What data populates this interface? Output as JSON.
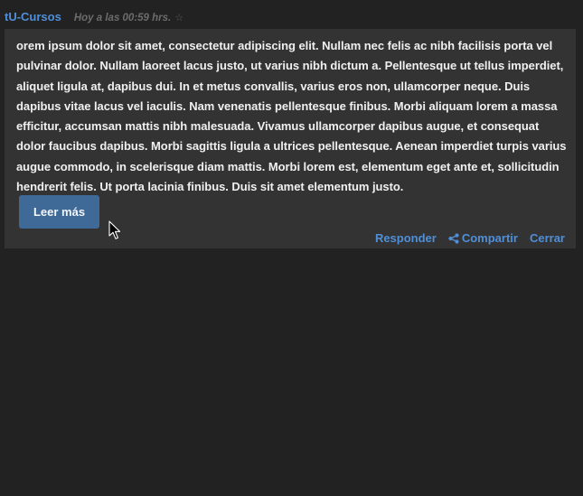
{
  "post": {
    "author": "tU-Cursos",
    "timestamp": "Hoy a las 00:59 hrs.",
    "star_glyph": "☆",
    "body": "orem ipsum dolor sit amet, consectetur adipiscing elit. Nullam nec felis ac nibh facilisis porta vel pulvinar dolor. Nullam laoreet lacus justo, ut varius nibh dictum a. Pellentesque ut tellus imperdiet, aliquet ligula at, dapibus dui. In et metus convallis, varius eros non, ullamcorper neque. Duis dapibus vitae lacus vel iaculis. Nam venenatis pellentesque finibus. Morbi aliquam lorem a massa efficitur, accumsan mattis nibh malesuada. Vivamus ullamcorper dapibus augue, et consequat dolor faucibus dapibus. Morbi sagittis ligula a ultrices pellentesque. Aenean imperdiet turpis varius augue commodo, in scelerisque diam mattis. Morbi lorem est, elementum eget ante et, sollicitudin hendrerit felis. Ut porta lacinia finibus. Duis sit amet elementum justo.",
    "read_more_label": "Leer más"
  },
  "actions": {
    "reply_label": "Responder",
    "share_label": "Compartir",
    "close_label": "Cerrar"
  },
  "icons": {
    "star": "star-outline-icon",
    "share": "share-icon",
    "cursor": "mouse-pointer-icon"
  },
  "colors": {
    "background": "#222222",
    "panel": "#333333",
    "link": "#4f8fd8",
    "button": "#3f6a98",
    "text": "#f0f0f0",
    "muted": "#6c6c6c"
  }
}
